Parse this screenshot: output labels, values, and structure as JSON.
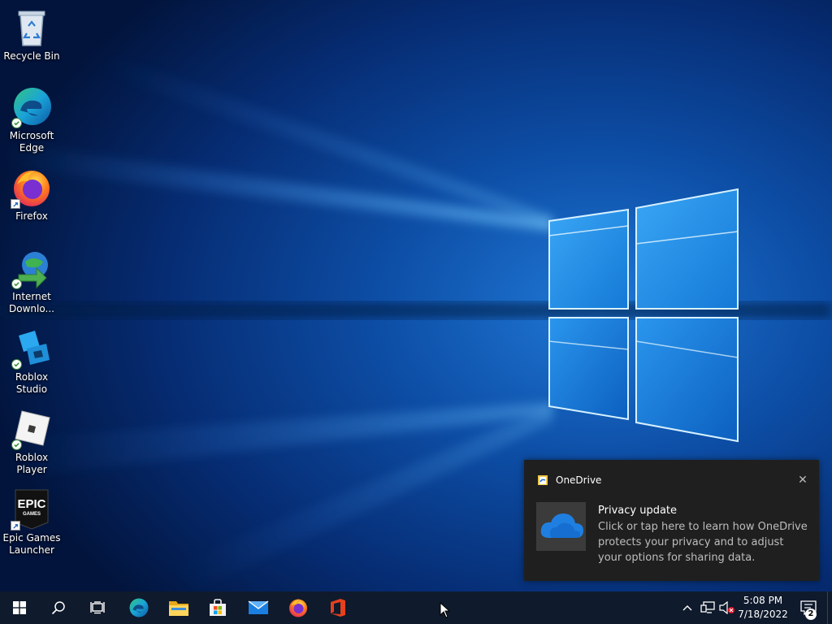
{
  "desktop": {
    "icons": [
      {
        "label": "Recycle Bin",
        "icon": "recycle-bin-icon"
      },
      {
        "label": "Microsoft Edge",
        "icon": "edge-icon",
        "status": "synced"
      },
      {
        "label": "Firefox",
        "icon": "firefox-icon",
        "status": "shortcut"
      },
      {
        "label": "Internet Downlo...",
        "icon": "internet-download-manager-icon",
        "status": "synced"
      },
      {
        "label": "Roblox Studio",
        "icon": "roblox-studio-icon",
        "status": "synced"
      },
      {
        "label": "Roblox Player",
        "icon": "roblox-player-icon",
        "status": "synced"
      },
      {
        "label": "Epic Games Launcher",
        "icon": "epic-games-icon",
        "status": "shortcut",
        "logo_text": "EPIC GAMES"
      }
    ]
  },
  "toast": {
    "app_name": "OneDrive",
    "title": "Privacy update",
    "message": "Click or tap here to learn how OneDrive protects your privacy and to adjust your options for sharing data.",
    "close_glyph": "✕"
  },
  "taskbar": {
    "buttons": [
      "start-icon",
      "search-icon",
      "task-view-icon",
      "edge-icon",
      "file-explorer-icon",
      "microsoft-store-icon",
      "mail-icon",
      "firefox-icon",
      "office-icon"
    ],
    "tray": [
      "chevron-up-icon",
      "network-icon",
      "volume-muted-icon"
    ],
    "time": "5:08 PM",
    "date": "7/18/2022",
    "notification_count": "2"
  },
  "colors": {
    "wallpaper_dark": "#031a4a",
    "wallpaper_light": "#1a7fe0",
    "taskbar": "#0f1a2c",
    "toast_bg": "#1f1f1f"
  }
}
